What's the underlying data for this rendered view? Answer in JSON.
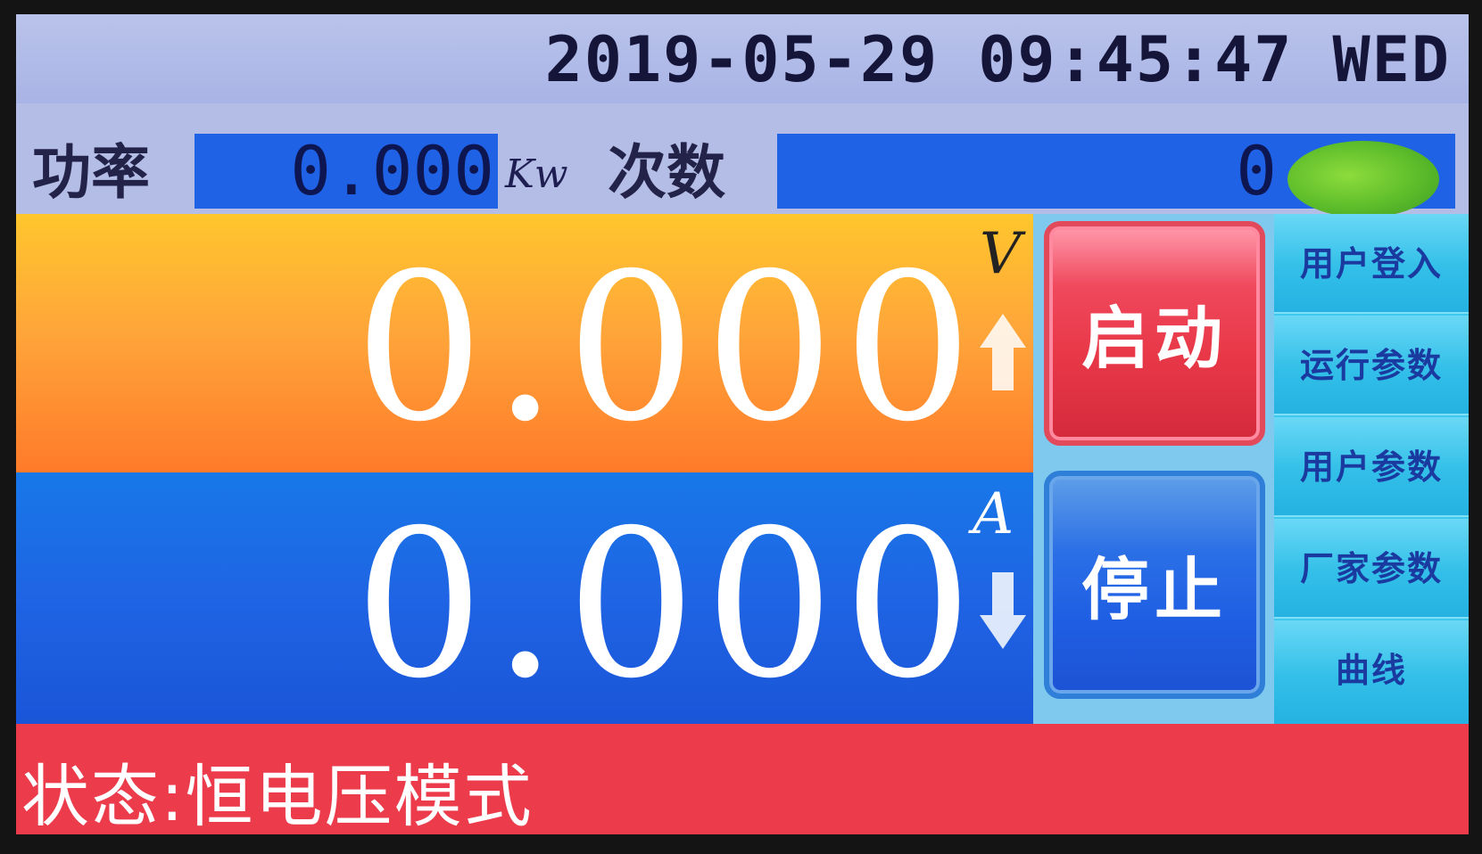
{
  "header": {
    "datetime": "2019-05-29 09:45:47 WED"
  },
  "power": {
    "label": "功率",
    "value": "0.000",
    "unit": "Kw"
  },
  "count": {
    "label": "次数",
    "value": "0"
  },
  "voltage": {
    "value": "0.000",
    "unit": "V"
  },
  "current": {
    "value": "0.000",
    "unit": "A"
  },
  "controls": {
    "start_label": "启动",
    "stop_label": "停止"
  },
  "menu": {
    "items": [
      {
        "label": "用户登入"
      },
      {
        "label": "运行参数"
      },
      {
        "label": "用户参数"
      },
      {
        "label": "厂家参数"
      },
      {
        "label": "曲线"
      }
    ]
  },
  "status": {
    "text": "状态:恒电压模式"
  },
  "colors": {
    "status_led": "#5cbc2a",
    "start": "#e83848",
    "stop": "#1f5fe4",
    "status_bar": "#ec3c4c"
  }
}
